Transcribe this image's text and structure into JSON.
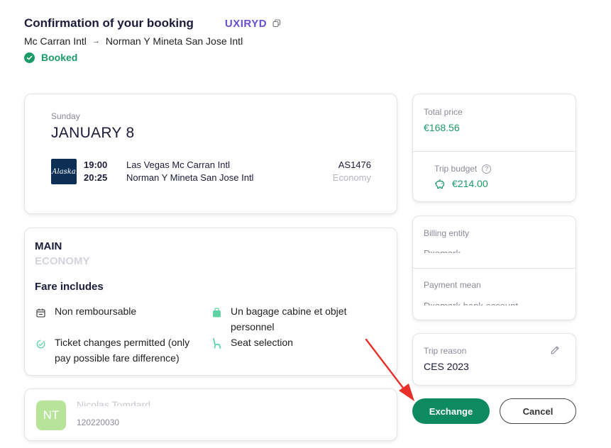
{
  "header": {
    "title": "Confirmation of your booking",
    "reference": "UXIRYD",
    "origin": "Mc Carran Intl",
    "destination": "Norman Y Mineta San Jose Intl",
    "status": "Booked"
  },
  "flight": {
    "day": "Sunday",
    "date": "JANUARY 8",
    "airline_logo_text": "Alaska",
    "departure_time": "19:00",
    "arrival_time": "20:25",
    "departure_airport": "Las Vegas Mc Carran Intl",
    "arrival_airport": "Norman Y Mineta San Jose Intl",
    "flight_number": "AS1476",
    "cabin": "Economy"
  },
  "fare": {
    "name": "MAIN",
    "class": "ECONOMY",
    "includes_label": "Fare includes",
    "features": [
      {
        "icon": "calendar-icon",
        "text": "Non remboursable"
      },
      {
        "icon": "bag-icon",
        "text": "Un bagage cabine et objet personnel"
      },
      {
        "icon": "ticket-change-icon",
        "text": "Ticket changes permitted (only pay possible fare difference)"
      },
      {
        "icon": "seat-icon",
        "text": "Seat selection"
      }
    ]
  },
  "traveler": {
    "initials": "NT",
    "name": "Nicolas Tomdard",
    "id": "120220030"
  },
  "pricing": {
    "total_label": "Total price",
    "total_value": "€168.56",
    "budget_label": "Trip budget",
    "budget_help": "?",
    "budget_value": "€214.00"
  },
  "billing": {
    "entity_label": "Billing entity",
    "entity_value": "Dxomark",
    "payment_label": "Payment mean",
    "payment_value": "Dxomark bank account"
  },
  "trip_reason": {
    "label": "Trip reason",
    "value": "CES 2023"
  },
  "actions": {
    "exchange_label": "Exchange",
    "cancel_label": "Cancel"
  },
  "colors": {
    "accent_green": "#0d8a5f",
    "status_green": "#1c9a6a",
    "reference_purple": "#6a4fcf",
    "annotation_red": "#e8302a"
  }
}
